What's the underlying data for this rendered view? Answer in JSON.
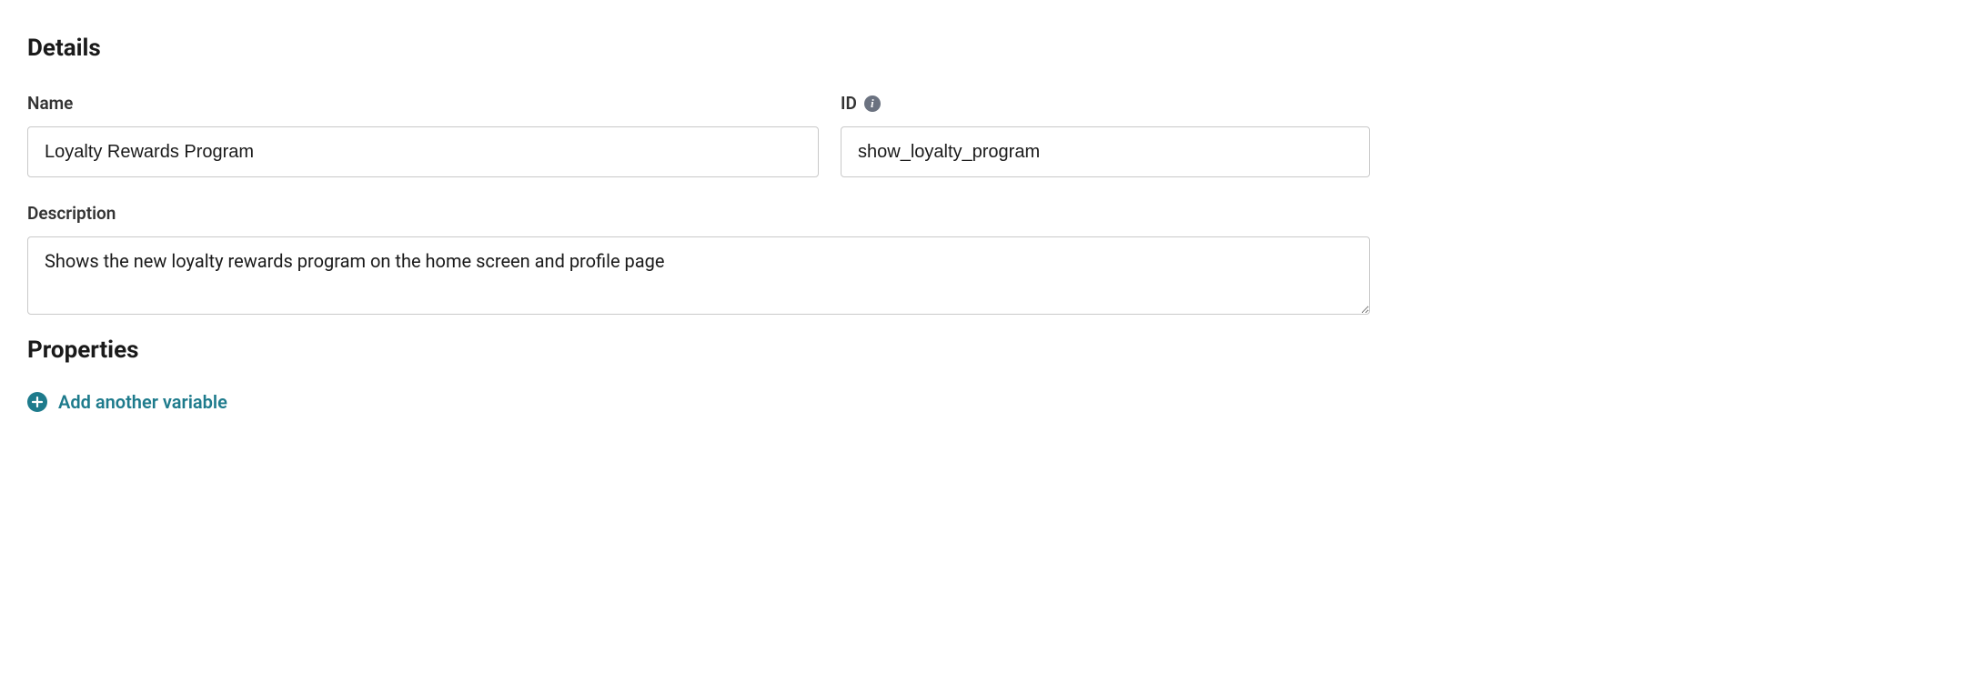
{
  "details": {
    "heading": "Details",
    "name_label": "Name",
    "name_value": "Loyalty Rewards Program",
    "id_label": "ID",
    "id_value": "show_loyalty_program",
    "description_label": "Description",
    "description_value": "Shows the new loyalty rewards program on the home screen and profile page"
  },
  "properties": {
    "heading": "Properties",
    "add_variable_label": "Add another variable"
  }
}
